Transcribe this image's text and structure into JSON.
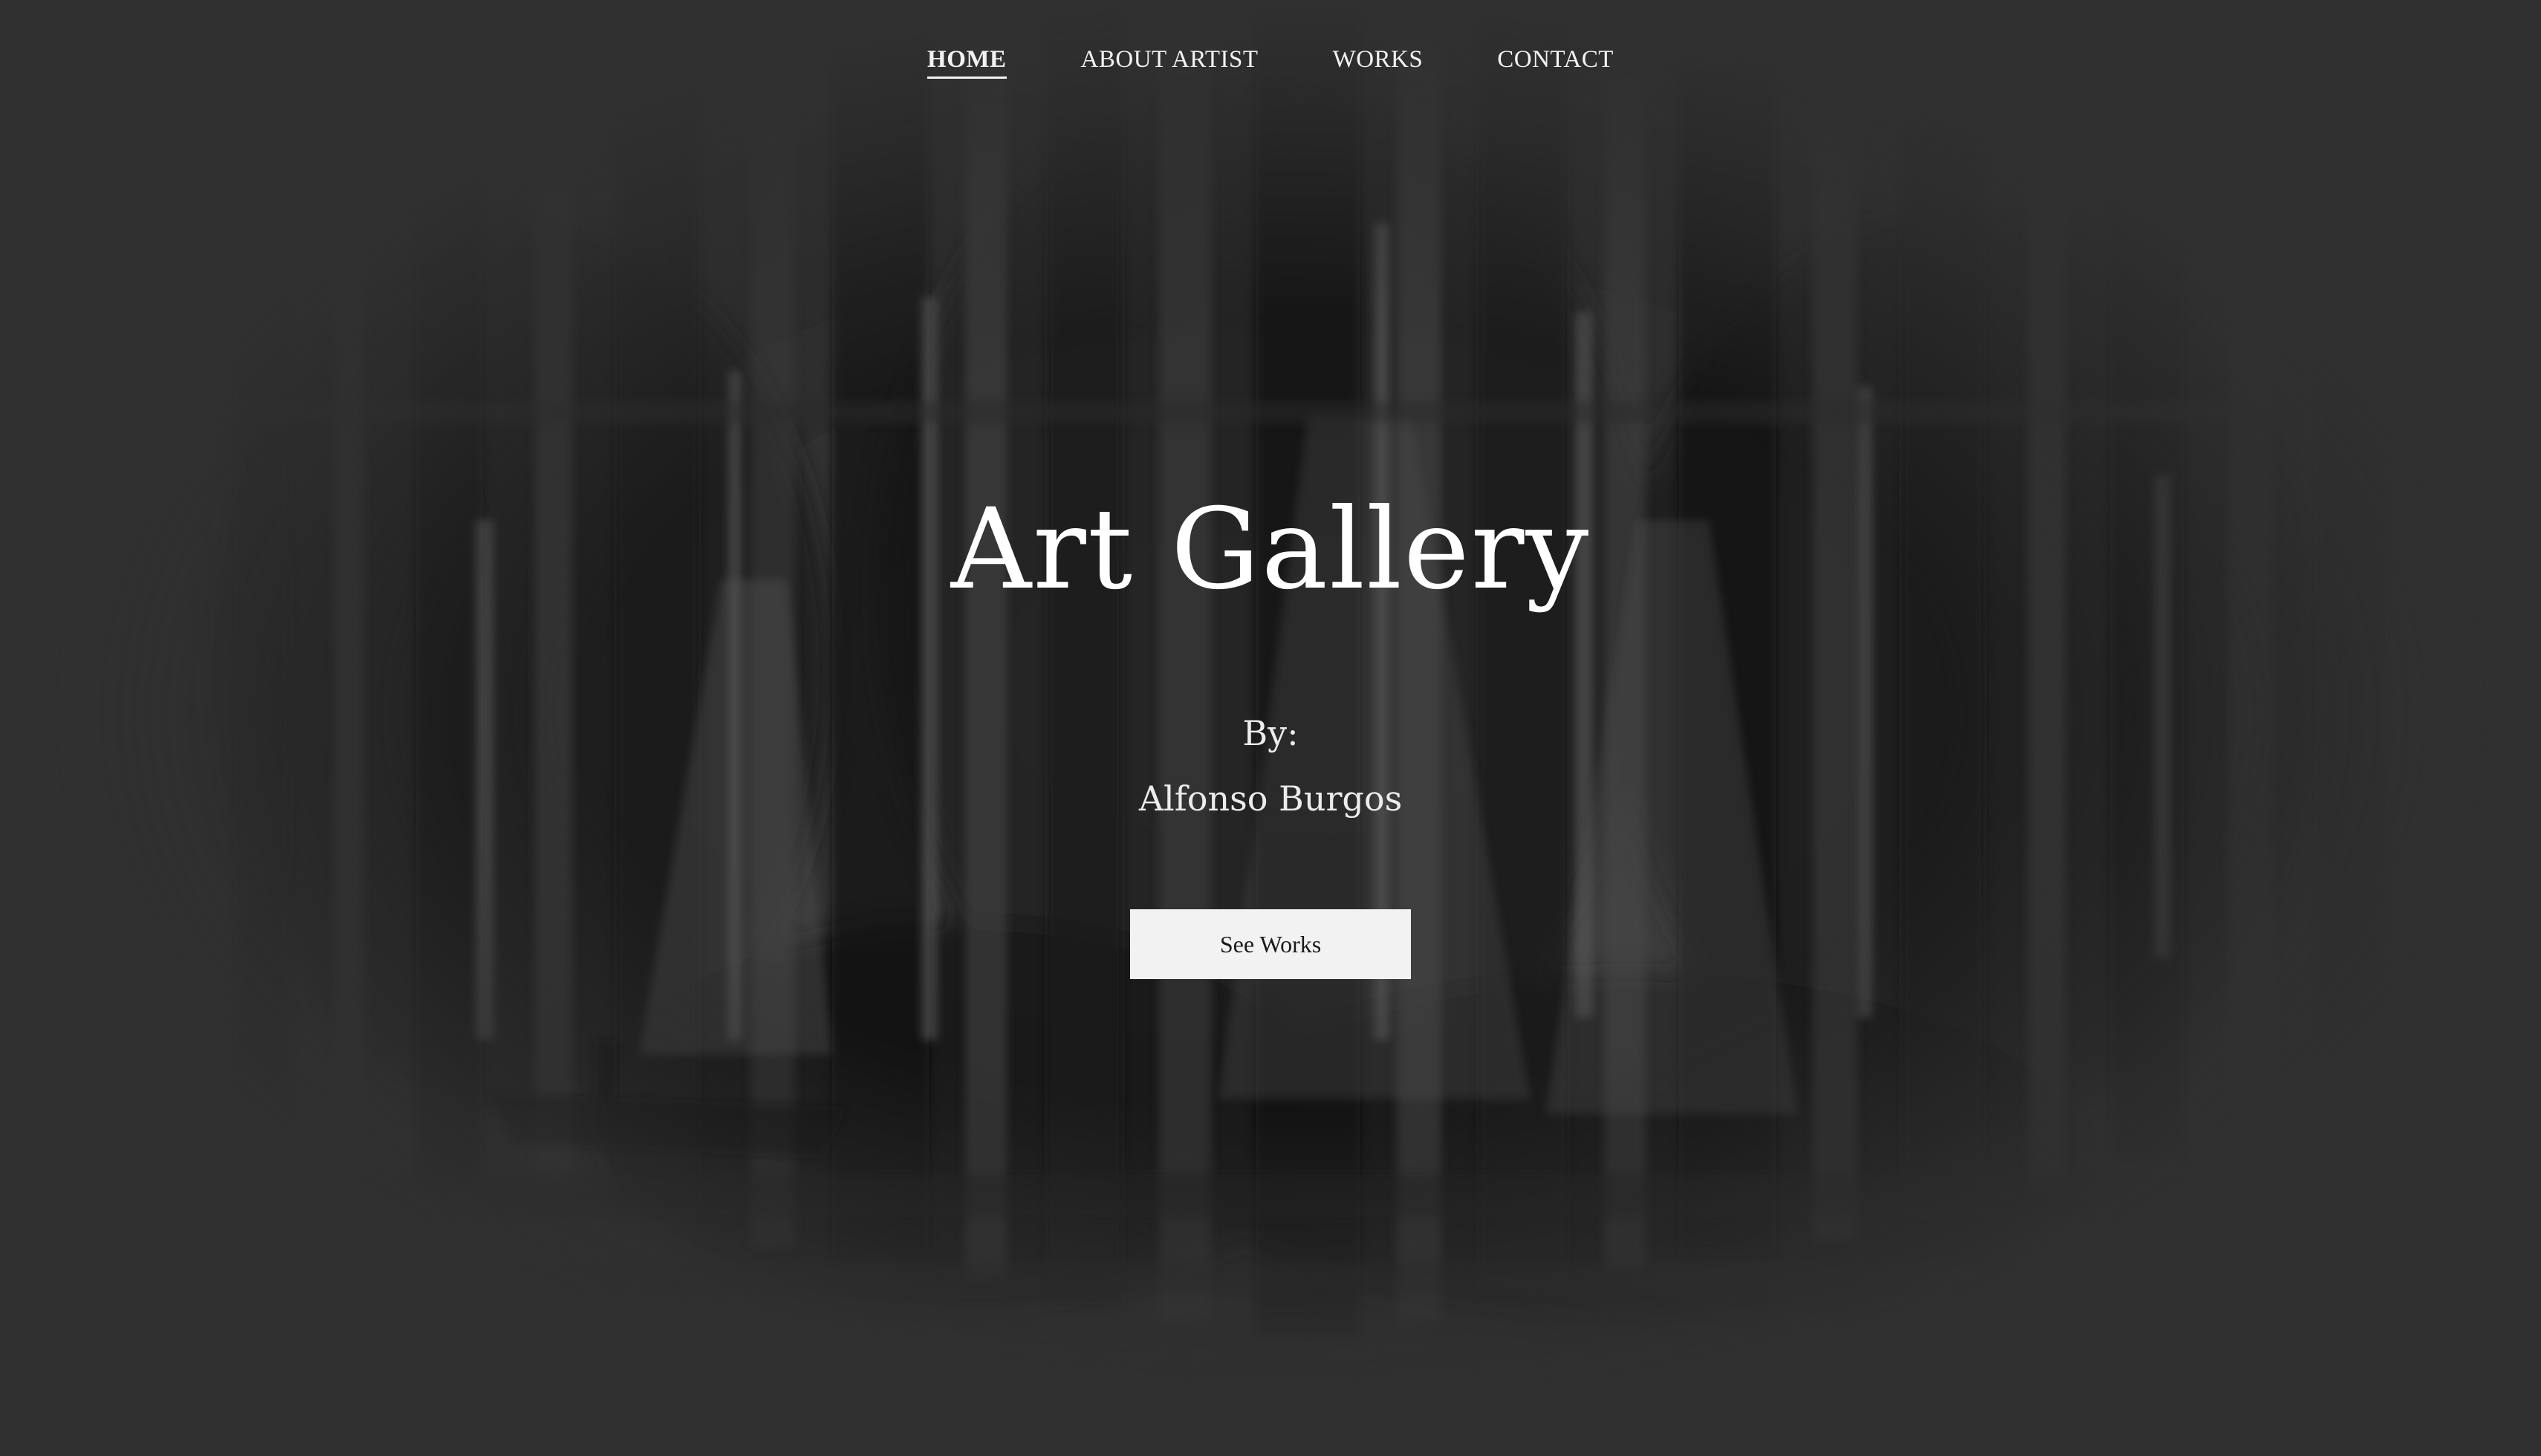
{
  "nav": {
    "items": [
      {
        "label": "HOME",
        "active": true
      },
      {
        "label": "ABOUT ARTIST",
        "active": false
      },
      {
        "label": "WORKS",
        "active": false
      },
      {
        "label": "CONTACT",
        "active": false
      }
    ]
  },
  "hero": {
    "title": "Art Gallery",
    "by_label": "By:",
    "artist_name": "Alfonso Burgos",
    "cta_label": "See Works",
    "background": "sailboat-harbor-painting-image"
  },
  "colors": {
    "page_background": "#303030",
    "text": "#ffffff",
    "button_background": "#f2f2f2",
    "button_text": "#1a1a1a"
  }
}
